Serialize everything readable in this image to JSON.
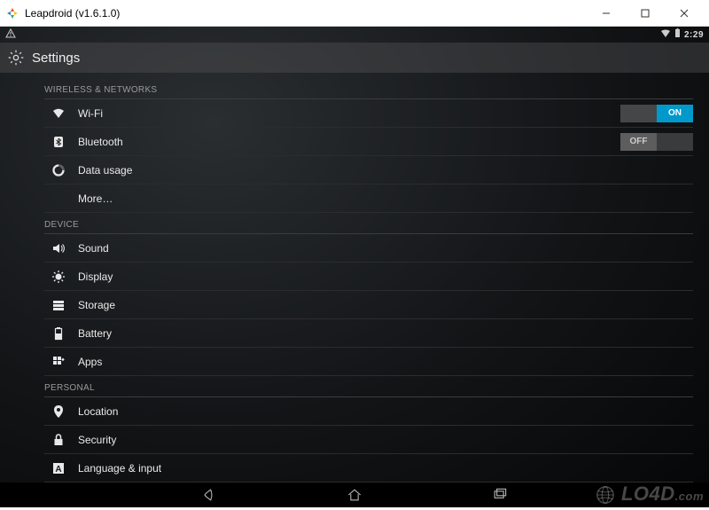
{
  "window": {
    "title": "Leapdroid (v1.6.1.0)"
  },
  "statusbar": {
    "time": "2:29"
  },
  "header": {
    "title": "Settings"
  },
  "sections": {
    "wireless_networks": "WIRELESS & NETWORKS",
    "device": "DEVICE",
    "personal": "PERSONAL"
  },
  "rows": {
    "wifi": {
      "label": "Wi-Fi"
    },
    "bluetooth": {
      "label": "Bluetooth"
    },
    "data_usage": {
      "label": "Data usage"
    },
    "more": {
      "label": "More…"
    },
    "sound": {
      "label": "Sound"
    },
    "display": {
      "label": "Display"
    },
    "storage": {
      "label": "Storage"
    },
    "battery": {
      "label": "Battery"
    },
    "apps": {
      "label": "Apps"
    },
    "location": {
      "label": "Location"
    },
    "security": {
      "label": "Security"
    },
    "language": {
      "label": "Language & input"
    }
  },
  "toggles": {
    "on": "ON",
    "off": "OFF"
  },
  "watermark": {
    "brand": "LO4D",
    "suffix": ".com"
  }
}
